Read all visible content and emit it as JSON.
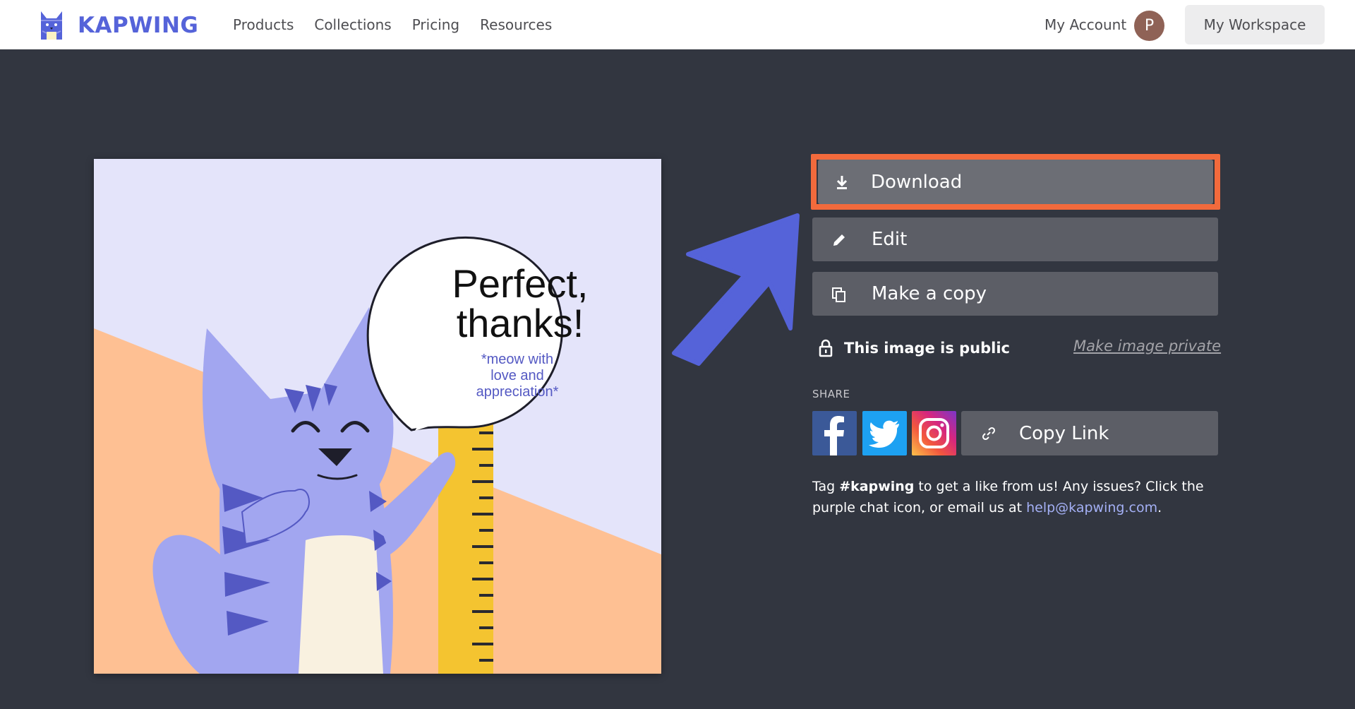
{
  "colors": {
    "brand": "#5563d9",
    "nav_text": "#4e4e52",
    "page_bg": "#323640",
    "button_bg": "#5c5e66",
    "download_bg": "#6c6e75",
    "highlight": "#f26a3c",
    "link": "#a4b0f5",
    "muted_link": "#a3a3a8",
    "avatar": "#8f6256",
    "facebook": "#3b5998",
    "twitter": "#1da1f2",
    "cat": "#a2a6f0",
    "cat_stripe": "#5459c3",
    "ruler": "#f4c430",
    "peach": "#fec093",
    "lavender": "#e4e4fa"
  },
  "header": {
    "logo_icon": "kapwing-cat-icon",
    "logo_text": "KAPWING",
    "nav": [
      "Products",
      "Collections",
      "Pricing",
      "Resources"
    ],
    "account_label": "My Account",
    "avatar_initial": "P",
    "workspace_label": "My Workspace"
  },
  "preview": {
    "bubble_line1": "Perfect,",
    "bubble_line2": "thanks!",
    "bubble_sub1": "*meow with",
    "bubble_sub2": "love and",
    "bubble_sub3": "appreciation*"
  },
  "actions": {
    "download": {
      "label": "Download",
      "icon": "download-icon"
    },
    "edit": {
      "label": "Edit",
      "icon": "pencil-icon"
    },
    "copy": {
      "label": "Make a copy",
      "icon": "copy-icon"
    }
  },
  "visibility": {
    "icon": "lock-icon",
    "status": "This image is public",
    "toggle_label": "Make image private"
  },
  "share": {
    "label": "SHARE",
    "networks": [
      "facebook-icon",
      "twitter-icon",
      "instagram-icon"
    ],
    "copy_link_label": "Copy Link",
    "copy_link_icon": "link-icon"
  },
  "footer_text": {
    "part1": "Tag ",
    "hashtag": "#kapwing",
    "part2": " to get a like from us! Any issues? Click the purple chat icon, or email us at ",
    "email": "help@kapwing.com",
    "part3": "."
  },
  "annotation": {
    "arrow_icon": "blue-arrow-icon"
  }
}
